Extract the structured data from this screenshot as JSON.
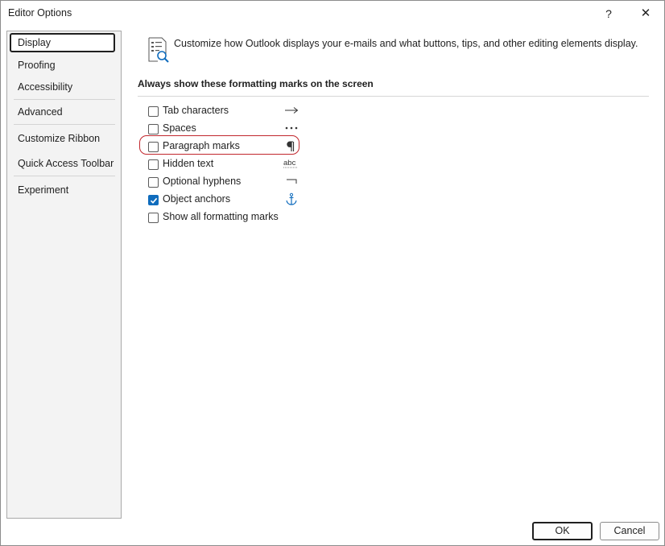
{
  "window": {
    "title": "Editor Options",
    "help_label": "?",
    "close_label": "✕"
  },
  "nav": {
    "items": [
      {
        "label": "Display",
        "selected": true
      },
      {
        "label": "Proofing"
      },
      {
        "label": "Accessibility"
      },
      {
        "label": "Advanced"
      },
      {
        "label": "Customize Ribbon"
      },
      {
        "label": "Quick Access Toolbar"
      },
      {
        "label": "Experiment"
      }
    ]
  },
  "content": {
    "header_text": "Customize how Outlook displays your e-mails and what buttons, tips, and other editing elements display.",
    "header_icon": "document-search-icon",
    "section_title": "Always show these formatting marks on the screen",
    "marks": [
      {
        "label": "Tab characters",
        "checked": false,
        "icon": "tab-arrow-icon"
      },
      {
        "label": "Spaces",
        "checked": false,
        "icon": "space-dots-icon"
      },
      {
        "label": "Paragraph marks",
        "checked": false,
        "icon": "pilcrow-icon",
        "highlighted": true
      },
      {
        "label": "Hidden text",
        "checked": false,
        "icon": "hidden-text-icon",
        "icon_text": "abc"
      },
      {
        "label": "Optional hyphens",
        "checked": false,
        "icon": "optional-hyphen-icon"
      },
      {
        "label": "Object anchors",
        "checked": true,
        "icon": "anchor-icon"
      },
      {
        "label": "Show all formatting marks",
        "checked": false
      }
    ]
  },
  "footer": {
    "ok_label": "OK",
    "cancel_label": "Cancel"
  },
  "colors": {
    "accent": "#0f6cbd",
    "highlight_ring": "#c1272d",
    "nav_background": "#f3f3f3"
  }
}
